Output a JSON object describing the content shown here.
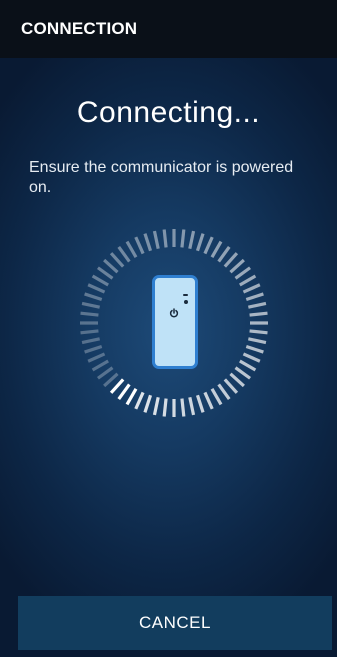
{
  "app_bar": {
    "title": "CONNECTION"
  },
  "main": {
    "heading": "Connecting...",
    "instruction": "Ensure the communicator is powered on."
  },
  "spinner": {
    "icon": "loading-spinner-icon",
    "tick_count": 60
  },
  "device": {
    "icon": "communicator-device-icon",
    "power_icon": "power-icon",
    "body_color": "#bfe2f7",
    "border_color": "#2f7fd0"
  },
  "footer": {
    "cancel_label": "CANCEL"
  },
  "colors": {
    "app_bar_background": "#0a1018",
    "screen_background": "#153a62",
    "button_background": "#123d5e",
    "text": "#ffffff"
  }
}
